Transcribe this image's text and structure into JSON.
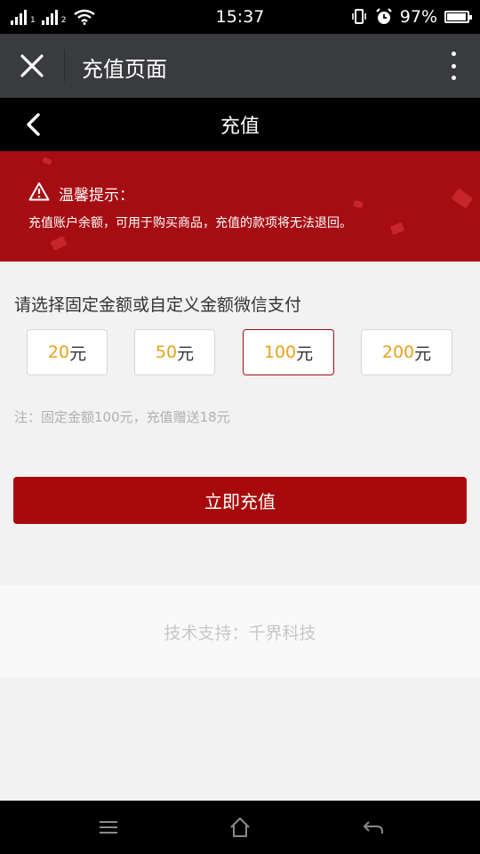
{
  "status_bar": {
    "time": "15:37",
    "sim1_label": "1",
    "sim2_label": "2",
    "battery_text": "97%",
    "battery_level": 0.97
  },
  "app_header": {
    "title": "充值页面"
  },
  "page_nav": {
    "title": "充值"
  },
  "notice": {
    "title": "温馨提示：",
    "text": "充值账户余额，可用于购买商品，充值的款项将无法退回。"
  },
  "recharge": {
    "instruction": "请选择固定金额或自定义金额微信支付",
    "unit": "元",
    "amounts": [
      {
        "value": "20",
        "selected": false
      },
      {
        "value": "50",
        "selected": false
      },
      {
        "value": "100",
        "selected": true
      },
      {
        "value": "200",
        "selected": false
      }
    ],
    "note": "注：固定金额100元，充值赠送18元",
    "submit_label": "立即充值"
  },
  "footer": {
    "support_text": "技术支持：千界科技"
  },
  "colors": {
    "brand_red": "#a80a0b",
    "amount_orange": "#e5a21a",
    "header_gray": "#3a3b3f"
  }
}
